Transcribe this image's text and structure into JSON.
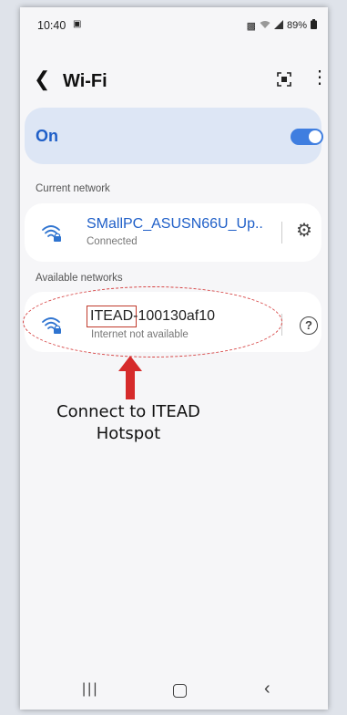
{
  "status_bar": {
    "time": "10:40",
    "battery": "89%"
  },
  "header": {
    "title": "Wi-Fi"
  },
  "wifi_toggle": {
    "label": "On",
    "state": true
  },
  "current_network": {
    "section_label": "Current network",
    "name": "SMallPC_ASUSN66U_Up..",
    "status": "Connected"
  },
  "available_networks": {
    "section_label": "Available networks",
    "items": [
      {
        "name_prefix": "ITEAD-",
        "name_suffix": "100130af10",
        "status": "Internet not available"
      }
    ]
  },
  "annotation": {
    "line1": "Connect to ITEAD",
    "line2": "Hotspot"
  },
  "colors": {
    "accent": "#1f5fc8",
    "toggle": "#3f7ee0",
    "annotation_red": "#d62b2b"
  },
  "icons": [
    "gallery-icon",
    "lock-icon",
    "wifi-status-icon",
    "signal-icon",
    "battery-icon",
    "back-icon",
    "qr-scan-icon",
    "more-options-icon",
    "wifi-lock-icon",
    "settings-gear-icon",
    "help-icon",
    "arrow-up-icon",
    "recents-icon",
    "home-icon",
    "nav-back-icon"
  ]
}
